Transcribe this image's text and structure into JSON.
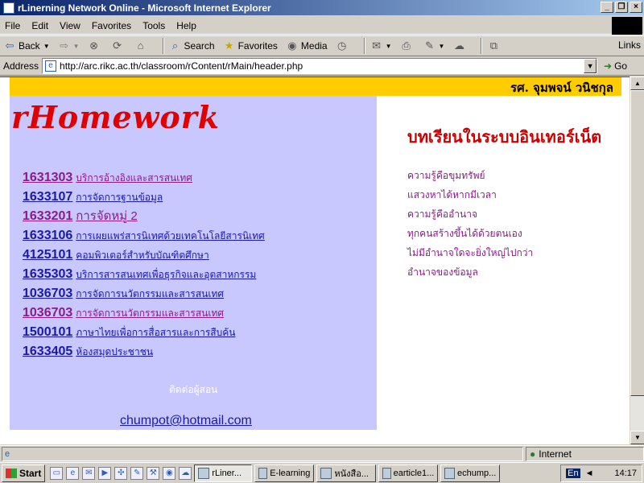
{
  "window": {
    "title": "rLinerning Network Online - Microsoft Internet Explorer",
    "buttons": [
      "_",
      "❐",
      "×"
    ]
  },
  "menu": [
    "File",
    "Edit",
    "View",
    "Favorites",
    "Tools",
    "Help"
  ],
  "toolbar": {
    "back": "Back",
    "search": "Search",
    "favorites": "Favorites",
    "media": "Media",
    "links": "Links"
  },
  "address": {
    "label": "Address",
    "url": "http://arc.rikc.ac.th/classroom/rContent/rMain/header.php",
    "go": "Go"
  },
  "page": {
    "teacher_name": "รศ. จุมพจน์ วนิชกุล",
    "logo": "rHomework",
    "heading": "บทเรียนในระบบอินเทอร์เน็ต",
    "courses": [
      {
        "code": "1631303",
        "title": "บริการอ้างอิงและสารสนเทศ",
        "visited": true
      },
      {
        "code": "1633107",
        "title": "การจัดการฐานข้อมูล",
        "visited": false
      },
      {
        "code": "1633201",
        "title": "การจัดหมู่ 2",
        "visited": true
      },
      {
        "code": "1633106",
        "title": "การเผยแพร่สารนิเทศด้วยเทคโนโลยีสารนิเทศ",
        "visited": false
      },
      {
        "code": "4125101",
        "title": "คอมพิวเตอร์สำหรับบัณฑิตศึกษา",
        "visited": false
      },
      {
        "code": "1635303",
        "title": "บริการสารสนเทศเพื่อธุรกิจและอุตสาหกรรม",
        "visited": false
      },
      {
        "code": "1036703",
        "title": "การจัดการนวัตกรรมและสารสนเทศ",
        "visited": false
      },
      {
        "code": "1036703",
        "title": "การจัดการนวัตกรรมและสารสนเทศ",
        "visited": true
      },
      {
        "code": "1500101",
        "title": "ภาษาไทยเพื่อการสื่อสารและการสืบค้น",
        "visited": false
      },
      {
        "code": "1633405",
        "title": "ห้องสมุดประชาชน",
        "visited": false
      }
    ],
    "contact_label": "ติดต่อผู้สอน",
    "email": "chumpot@hotmail.com",
    "quotes": [
      "ความรู้คือขุมทรัพย์",
      "แสวงหาได้หากมีเวลา",
      "ความรู้คืออำนาจ",
      "ทุกคนสร้างขึ้นได้ด้วยตนเอง",
      "ไม่มีอำนาจใดจะยิ่งใหญ่ไปกว่า",
      "อำนาจของข้อมูล"
    ]
  },
  "status": {
    "zone": "Internet"
  },
  "taskbar": {
    "start": "Start",
    "tasks": [
      "rLiner...",
      "E-learning",
      "หนังสือ...",
      "earticle1...",
      "echump..."
    ],
    "lang": "En",
    "time": "14:17"
  }
}
